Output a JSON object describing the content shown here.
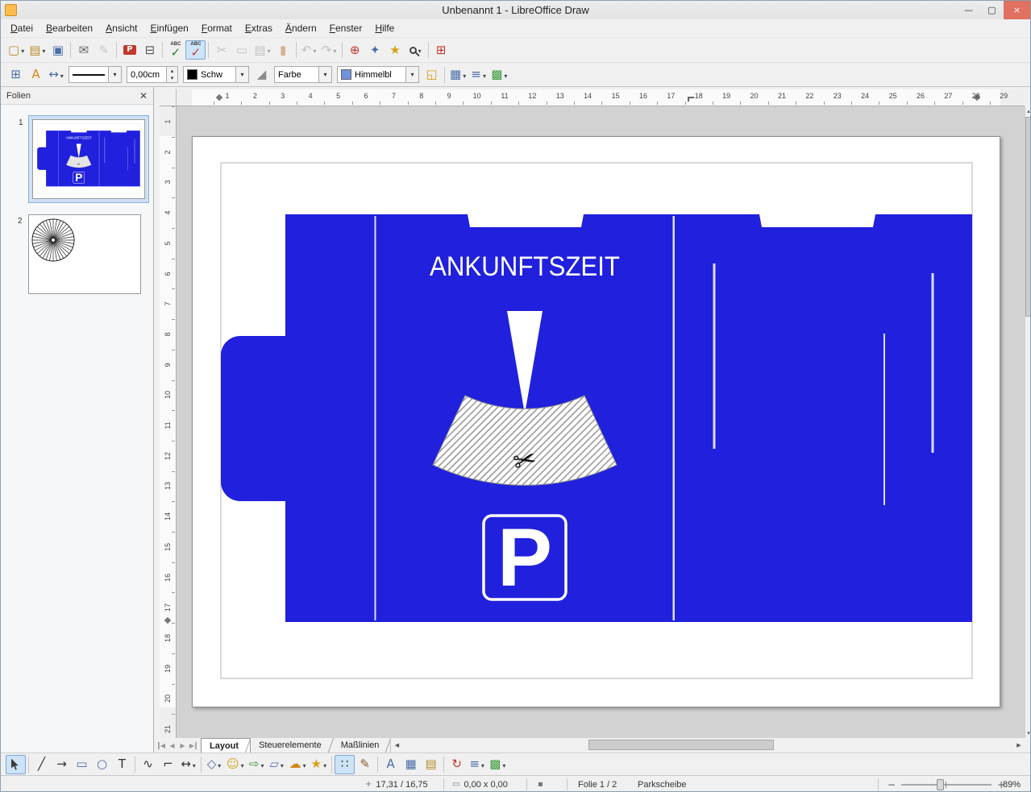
{
  "window": {
    "title": "Unbenannt 1 - LibreOffice Draw",
    "controls": {
      "minimize": "—",
      "maximize": "▢",
      "close": "×"
    }
  },
  "menubar": {
    "items": [
      "Datei",
      "Bearbeiten",
      "Ansicht",
      "Einfügen",
      "Format",
      "Extras",
      "Ändern",
      "Fenster",
      "Hilfe"
    ]
  },
  "standard_toolbar": {
    "icons": [
      {
        "name": "new-icon",
        "glyph": "▢",
        "color": "#b58b2a",
        "dd": true
      },
      {
        "name": "open-icon",
        "glyph": "▤",
        "color": "#b58b2a",
        "dd": true
      },
      {
        "name": "save-icon",
        "glyph": "▣",
        "color": "#4a6da7"
      },
      {
        "sep": true
      },
      {
        "name": "email-icon",
        "glyph": "✉",
        "color": "#666666"
      },
      {
        "name": "edit-file-icon",
        "glyph": "✎",
        "color": "#999999",
        "disabled": true
      },
      {
        "sep": true
      },
      {
        "name": "export-pdf-icon",
        "glyph": "P",
        "color": "#ffffff",
        "bg": "#c0392b"
      },
      {
        "name": "print-icon",
        "glyph": "⊟",
        "color": "#555555"
      },
      {
        "sep": true
      },
      {
        "name": "spellcheck-icon",
        "glyph": "✓",
        "color": "#2e7d32",
        "sub": "ABC"
      },
      {
        "name": "autospellcheck-icon",
        "glyph": "✓",
        "color": "#c0392b",
        "sub": "ABC",
        "active": true
      },
      {
        "sep": true
      },
      {
        "name": "cut-icon",
        "glyph": "✂",
        "color": "#888888",
        "disabled": true
      },
      {
        "name": "copy-icon",
        "glyph": "▭",
        "color": "#888888",
        "disabled": true
      },
      {
        "name": "paste-icon",
        "glyph": "▤",
        "color": "#888888",
        "disabled": true,
        "dd": true
      },
      {
        "name": "clone-formatting-icon",
        "glyph": "▮",
        "color": "#b5651d",
        "disabled": true
      },
      {
        "sep": true
      },
      {
        "name": "undo-icon",
        "glyph": "↶",
        "color": "#888888",
        "disabled": true,
        "dd": true
      },
      {
        "name": "redo-icon",
        "glyph": "↷",
        "color": "#888888",
        "disabled": true,
        "dd": true
      },
      {
        "sep": true
      },
      {
        "name": "hyperlink-icon",
        "glyph": "⊕",
        "color": "#c0392b"
      },
      {
        "name": "navigator-icon",
        "glyph": "✦",
        "color": "#4a6da7"
      },
      {
        "name": "gallery-icon",
        "glyph": "★",
        "color": "#d4a017"
      },
      {
        "name": "zoom-icon",
        "shape": "zoom",
        "dd": true
      },
      {
        "sep": true
      },
      {
        "name": "helplines-icon",
        "glyph": "⊞",
        "color": "#c0392b"
      }
    ]
  },
  "line_toolbar": {
    "left_icons": [
      {
        "name": "table-grid-icon",
        "glyph": "⊞",
        "color": "#4a6da7"
      },
      {
        "name": "styles-icon",
        "glyph": "A",
        "color": "#d4861c"
      },
      {
        "name": "arrow-style-icon",
        "glyph": "↔",
        "color": "#4a6da7",
        "dd": true
      }
    ],
    "line_width": "0,00cm",
    "line_color_label": "Schw",
    "line_color_swatch": "#000000",
    "paint_can_icons": [
      {
        "name": "paint-can-icon",
        "glyph": "◢",
        "color": "#8a8a8a"
      }
    ],
    "fill_type_label": "Farbe",
    "fill_color_label": "Himmelbl",
    "fill_color_swatch": "#7191de",
    "right_icons": [
      {
        "name": "shadow-icon",
        "glyph": "◱",
        "color": "#d4a017"
      },
      {
        "sep": true
      },
      {
        "name": "snap-grid-icon",
        "glyph": "▦",
        "color": "#4a6da7",
        "dd": true
      },
      {
        "name": "align-icon",
        "glyph": "≡",
        "color": "#4a6da7",
        "dd": true
      },
      {
        "name": "arrange-icon",
        "glyph": "▩",
        "color": "#3a9a3a",
        "dd": true
      }
    ]
  },
  "slides_panel": {
    "title": "Folien",
    "close_icon": "✕",
    "slides": [
      {
        "number": "1"
      },
      {
        "number": "2"
      }
    ]
  },
  "rulers": {
    "horizontal": [
      "1",
      "2",
      "3",
      "4",
      "5",
      "6",
      "7",
      "8",
      "9",
      "10",
      "11",
      "12",
      "13",
      "14",
      "15",
      "16",
      "17",
      "18",
      "19",
      "20",
      "21",
      "22",
      "23",
      "24",
      "25",
      "26",
      "27",
      "28",
      "29"
    ],
    "vertical": [
      "1",
      "2",
      "3",
      "4",
      "5",
      "6",
      "7",
      "8",
      "9",
      "10",
      "11",
      "12",
      "13",
      "14",
      "15",
      "16",
      "17",
      "18",
      "19",
      "20",
      "21"
    ]
  },
  "canvas": {
    "blue": "#2020dd",
    "title_text": "ANKUNFTSZEIT",
    "p_label": "P",
    "scissors_glyph": "✂"
  },
  "view_tabs": [
    {
      "label": "Layout",
      "active": true
    },
    {
      "label": "Steuerelemente",
      "active": false
    },
    {
      "label": "Maßlinien",
      "active": false
    }
  ],
  "drawing_toolbar": {
    "icons": [
      {
        "name": "select-icon",
        "shape": "cursor",
        "active": true
      },
      {
        "sep": true
      },
      {
        "name": "line-icon",
        "glyph": "╱",
        "color": "#333333"
      },
      {
        "name": "arrow-icon",
        "glyph": "→",
        "color": "#333333"
      },
      {
        "name": "rectangle-icon",
        "glyph": "▭",
        "color": "#4a6da7"
      },
      {
        "name": "ellipse-icon",
        "glyph": "○",
        "color": "#4a6da7"
      },
      {
        "name": "text-icon",
        "glyph": "T",
        "color": "#333333"
      },
      {
        "sep": true
      },
      {
        "name": "curve-icon",
        "glyph": "∿",
        "color": "#333333"
      },
      {
        "name": "connector-icon",
        "glyph": "⌐",
        "color": "#333333"
      },
      {
        "name": "line-arrow-style-icon",
        "glyph": "↔",
        "color": "#333333",
        "dd": true
      },
      {
        "sep": true
      },
      {
        "name": "basic-shapes-icon",
        "glyph": "◇",
        "color": "#4a6da7",
        "dd": true
      },
      {
        "name": "symbol-shapes-icon",
        "glyph": "☺",
        "color": "#d4a017",
        "dd": true
      },
      {
        "name": "block-arrows-icon",
        "glyph": "⇨",
        "color": "#3a9a3a",
        "dd": true
      },
      {
        "name": "flowchart-icon",
        "glyph": "▱",
        "color": "#4a6da7",
        "dd": true
      },
      {
        "name": "callouts-icon",
        "glyph": "☁",
        "color": "#d4861c",
        "dd": true
      },
      {
        "name": "stars-icon",
        "glyph": "★",
        "color": "#d4a017",
        "dd": true
      },
      {
        "sep": true
      },
      {
        "name": "edit-points-icon",
        "glyph": "∷",
        "color": "#333333",
        "active": true
      },
      {
        "name": "gluepoints-icon",
        "glyph": "✎",
        "color": "#8a5a2a"
      },
      {
        "sep": true
      },
      {
        "name": "fontwork-icon",
        "glyph": "A",
        "color": "#4a6da7"
      },
      {
        "name": "image-icon",
        "glyph": "▦",
        "color": "#4a6da7"
      },
      {
        "name": "gallery2-icon",
        "glyph": "▤",
        "color": "#b58b2a"
      },
      {
        "sep": true
      },
      {
        "name": "rotate-icon",
        "glyph": "↻",
        "color": "#c0392b"
      },
      {
        "name": "alignment-icon",
        "glyph": "≡",
        "color": "#4a6da7",
        "dd": true
      },
      {
        "name": "arrange2-icon",
        "glyph": "▩",
        "color": "#3a9a3a",
        "dd": true
      }
    ]
  },
  "statusbar": {
    "position_icon": "+",
    "position": "17,31 / 16,75",
    "size_icon": "▭",
    "size": "0,00 x 0,00",
    "modified_icon": "▪",
    "slide": "Folie 1 / 2",
    "style": "Parkscheibe",
    "zoom_out": "−",
    "zoom_in": "+",
    "zoom": "89%"
  }
}
